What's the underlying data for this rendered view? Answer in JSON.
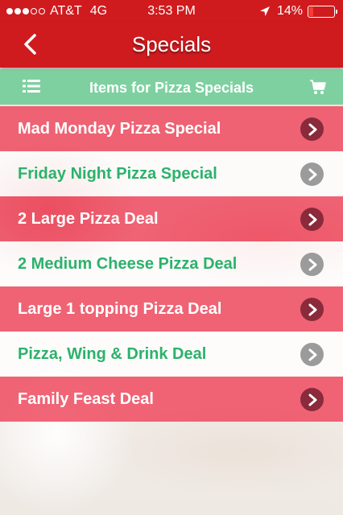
{
  "status_bar": {
    "carrier": "AT&T",
    "network": "4G",
    "time": "3:53 PM",
    "battery_percent": "14%",
    "signal_bars": 3,
    "signal_total": 5
  },
  "nav": {
    "title": "Specials",
    "back_icon": "chevron-left-icon"
  },
  "subbar": {
    "title": "Items for Pizza Specials",
    "left_icon": "list-icon",
    "right_icon": "cart-icon"
  },
  "colors": {
    "nav_red": "#d01b1e",
    "subbar_green": "#6ecd96",
    "row_red": "#ee445a",
    "row_green_text": "#2bb26b"
  },
  "specials": [
    {
      "label": "Mad Monday Pizza Special",
      "style": "red"
    },
    {
      "label": "Friday Night Pizza Special",
      "style": "white"
    },
    {
      "label": "2 Large Pizza Deal",
      "style": "red"
    },
    {
      "label": "2 Medium Cheese Pizza Deal",
      "style": "white"
    },
    {
      "label": "Large 1 topping Pizza Deal",
      "style": "red"
    },
    {
      "label": "Pizza, Wing & Drink Deal",
      "style": "white"
    },
    {
      "label": "Family Feast Deal",
      "style": "red"
    }
  ]
}
